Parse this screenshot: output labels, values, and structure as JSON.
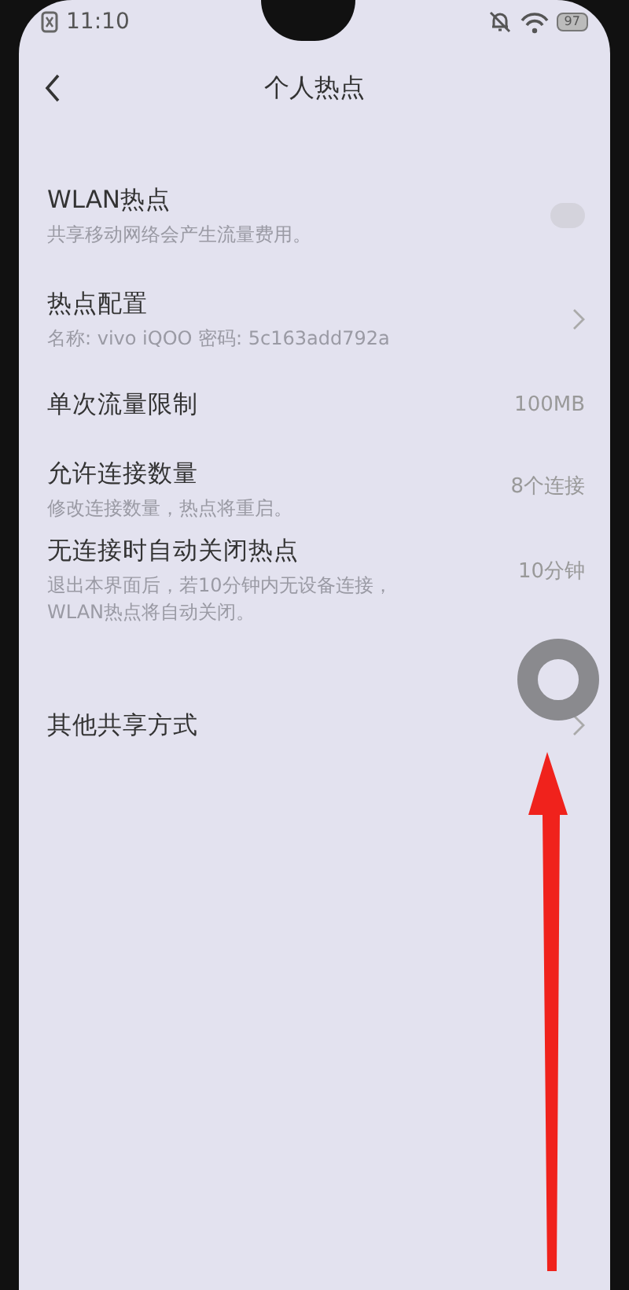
{
  "status_bar": {
    "time": "11:10",
    "battery": "97"
  },
  "header": {
    "title": "个人热点"
  },
  "items": [
    {
      "kind": "toggle",
      "title": "WLAN热点",
      "subtitle": "共享移动网络会产生流量费用。",
      "on": false
    },
    {
      "kind": "link",
      "title": "热点配置",
      "subtitle": "名称: vivo iQOO  密码: 5c163add792a"
    },
    {
      "kind": "value",
      "title": "单次流量限制",
      "value": "100MB"
    },
    {
      "kind": "value",
      "title": "允许连接数量",
      "subtitle": "修改连接数量，热点将重启。",
      "value": "8个连接"
    },
    {
      "kind": "value",
      "title": "无连接时自动关闭热点",
      "subtitle": "退出本界面后，若10分钟内无设备连接，WLAN热点将自动关闭。",
      "value": "10分钟"
    },
    {
      "kind": "link",
      "title": "其他共享方式"
    }
  ]
}
